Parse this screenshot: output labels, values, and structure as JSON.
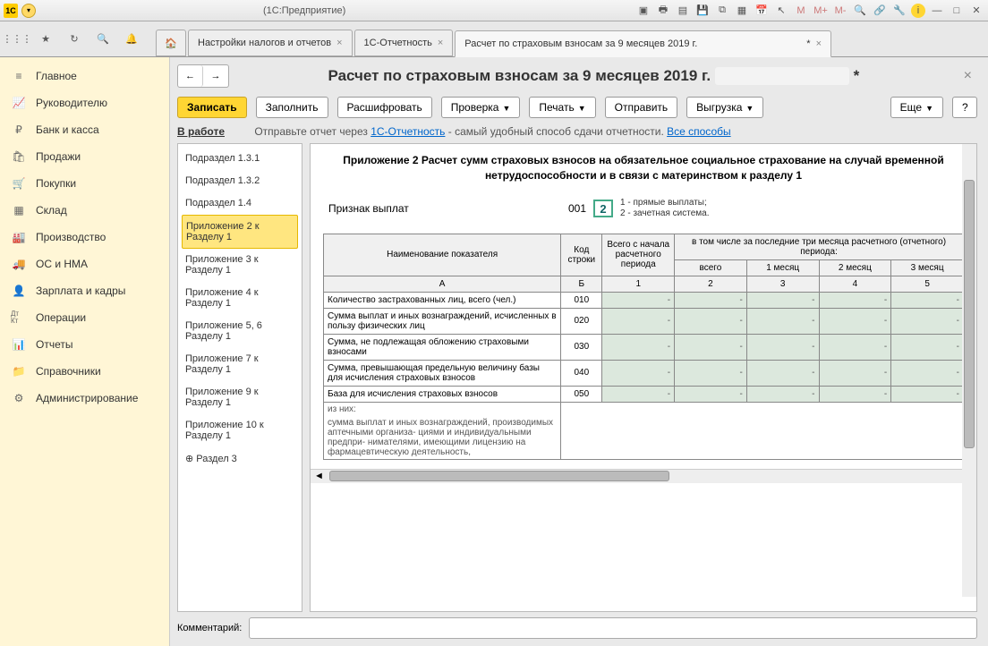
{
  "window": {
    "title": "(1С:Предприятие)"
  },
  "winbtns": {
    "m": "M",
    "mplus": "M+",
    "mminus": "M-"
  },
  "tabs": {
    "home": "",
    "t1": "Настройки налогов и отчетов",
    "t2": "1С-Отчетность",
    "t3": "Расчет по страховым взносам за 9 месяцев 2019 г.",
    "mod": "*",
    "close": "×"
  },
  "sidebar": {
    "items": [
      {
        "label": "Главное",
        "icon": "≡"
      },
      {
        "label": "Руководителю",
        "icon": "📈"
      },
      {
        "label": "Банк и касса",
        "icon": "₽"
      },
      {
        "label": "Продажи",
        "icon": "🛍"
      },
      {
        "label": "Покупки",
        "icon": "🛒"
      },
      {
        "label": "Склад",
        "icon": "▦"
      },
      {
        "label": "Производство",
        "icon": "🏭"
      },
      {
        "label": "ОС и НМА",
        "icon": "🚚"
      },
      {
        "label": "Зарплата и кадры",
        "icon": "👤"
      },
      {
        "label": "Операции",
        "icon": "Дт\nКт"
      },
      {
        "label": "Отчеты",
        "icon": "📊"
      },
      {
        "label": "Справочники",
        "icon": "📁"
      },
      {
        "label": "Администрирование",
        "icon": "⚙"
      }
    ]
  },
  "page": {
    "title": "Расчет по страховым взносам за 9 месяцев 2019 г.",
    "mod": "*"
  },
  "toolbar": {
    "zapisat": "Записать",
    "zapolnit": "Заполнить",
    "rasshifrovat": "Расшифровать",
    "proverka": "Проверка",
    "pechat": "Печать",
    "otpravit": "Отправить",
    "vygruzka": "Выгрузка",
    "eshche": "Еще",
    "help": "?"
  },
  "linkrow": {
    "status": "В работе",
    "text": "Отправьте отчет через ",
    "link1": "1С-Отчетность",
    "text2": " - самый удобный способ сдачи отчетности. ",
    "link2": "Все способы"
  },
  "tree": {
    "n0": "Подраздел 1.3.1",
    "n1": "Подраздел 1.3.2",
    "n2": "Подраздел 1.4",
    "n3": "Приложение 2 к Разделу 1",
    "n4": "Приложение 3 к Разделу 1",
    "n5": "Приложение 4 к Разделу 1",
    "n6": "Приложение 5, 6 Разделу 1",
    "n7": "Приложение 7 к Разделу 1",
    "n8": "Приложение 9 к Разделу 1",
    "n9": "Приложение 10 к Разделу 1",
    "n10": "⊕        Раздел 3"
  },
  "doc": {
    "title": "Приложение 2 Расчет сумм страховых взносов на обязательное социальное страхование на случай временной нетрудоспособности и в связи с материнством к разделу 1",
    "sign_label": "Признак выплат",
    "sign_code": "001",
    "sign_value": "2",
    "sign_desc1": "1 - прямые выплаты;",
    "sign_desc2": "2 - зачетная система.",
    "th_name": "Наименование показателя",
    "th_code": "Код строки",
    "th_total": "Всего с начала расчетного периода",
    "th_last3": "в том числе за последние три месяца расчетного (отчетного) периода:",
    "th_vsego": "всего",
    "th_m1": "1 месяц",
    "th_m2": "2 месяц",
    "th_m3": "3 месяц",
    "hA": "А",
    "hB": "Б",
    "h1": "1",
    "h2": "2",
    "h3": "3",
    "h4": "4",
    "h5": "5",
    "rows": [
      {
        "name": "Количество застрахованных лиц, всего (чел.)",
        "code": "010"
      },
      {
        "name": "Сумма выплат и иных вознаграждений, исчисленных в пользу физических лиц",
        "code": "020"
      },
      {
        "name": "Сумма, не подлежащая обложению страховыми взносами",
        "code": "030"
      },
      {
        "name": "Сумма, превышающая предельную величину базы для исчисления страховых взносов",
        "code": "040"
      },
      {
        "name": "База для исчисления страховых взносов",
        "code": "050"
      }
    ],
    "note1": "из них:",
    "note2": "сумма выплат и иных вознаграждений, производимых аптечными организа- циями и индивидуальными предпри- нимателями, имеющими лицензию на фармацевтическую деятельность,",
    "dash": "-"
  },
  "comment": {
    "label": "Комментарий:",
    "value": ""
  }
}
